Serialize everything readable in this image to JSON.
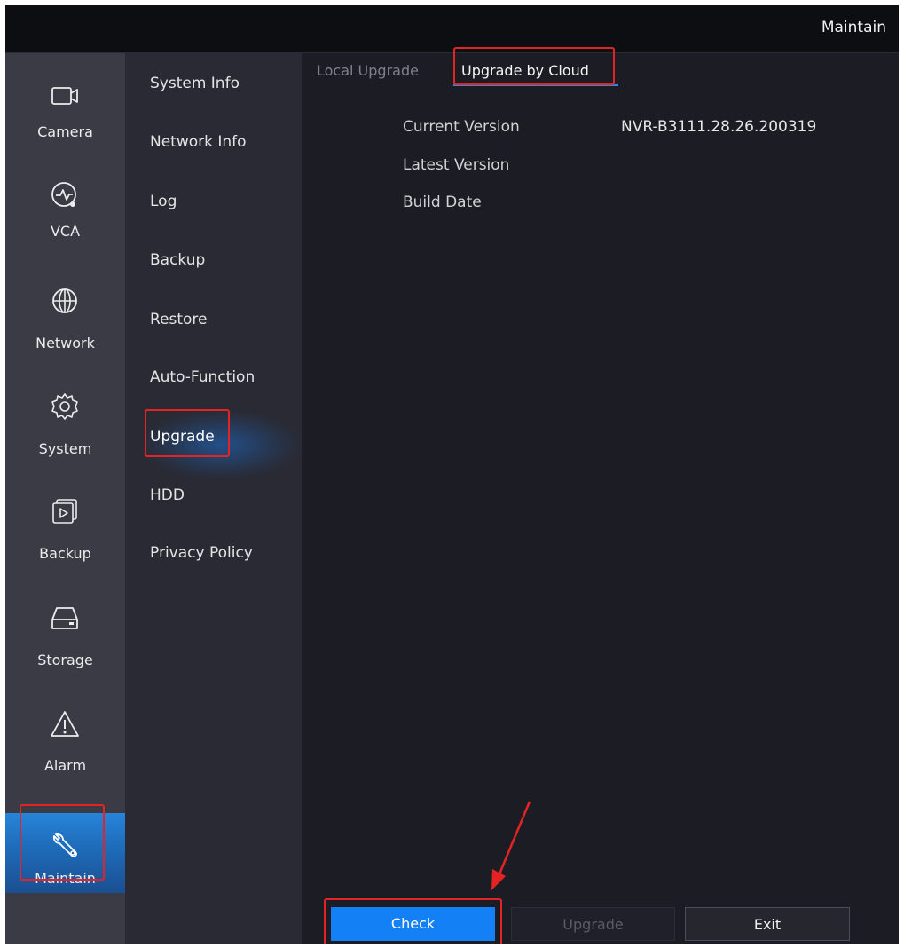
{
  "header": {
    "title": "Maintain"
  },
  "sidebar": {
    "items": [
      {
        "label": "Camera",
        "icon": "camera-icon"
      },
      {
        "label": "VCA",
        "icon": "vca-icon"
      },
      {
        "label": "Network",
        "icon": "globe-icon"
      },
      {
        "label": "System",
        "icon": "gear-icon"
      },
      {
        "label": "Backup",
        "icon": "backup-play-icon"
      },
      {
        "label": "Storage",
        "icon": "hdd-icon"
      },
      {
        "label": "Alarm",
        "icon": "warning-icon"
      },
      {
        "label": "Maintain",
        "icon": "wrench-icon",
        "active": true
      }
    ]
  },
  "submenu": {
    "items": [
      {
        "label": "System Info"
      },
      {
        "label": "Network Info"
      },
      {
        "label": "Log"
      },
      {
        "label": "Backup"
      },
      {
        "label": "Restore"
      },
      {
        "label": "Auto-Function"
      },
      {
        "label": "Upgrade",
        "active": true
      },
      {
        "label": "HDD"
      },
      {
        "label": "Privacy Policy"
      }
    ]
  },
  "tabs": [
    {
      "label": "Local Upgrade",
      "active": false
    },
    {
      "label": "Upgrade by Cloud",
      "active": true
    }
  ],
  "info": {
    "current_version_label": "Current Version",
    "current_version_value": "NVR-B3111.28.26.200319",
    "latest_version_label": "Latest Version",
    "latest_version_value": "",
    "build_date_label": "Build Date",
    "build_date_value": ""
  },
  "buttons": {
    "check": "Check",
    "upgrade": "Upgrade",
    "exit": "Exit"
  },
  "colors": {
    "accent": "#1480f5",
    "highlight": "#e42424",
    "background": "#1c1d24"
  }
}
